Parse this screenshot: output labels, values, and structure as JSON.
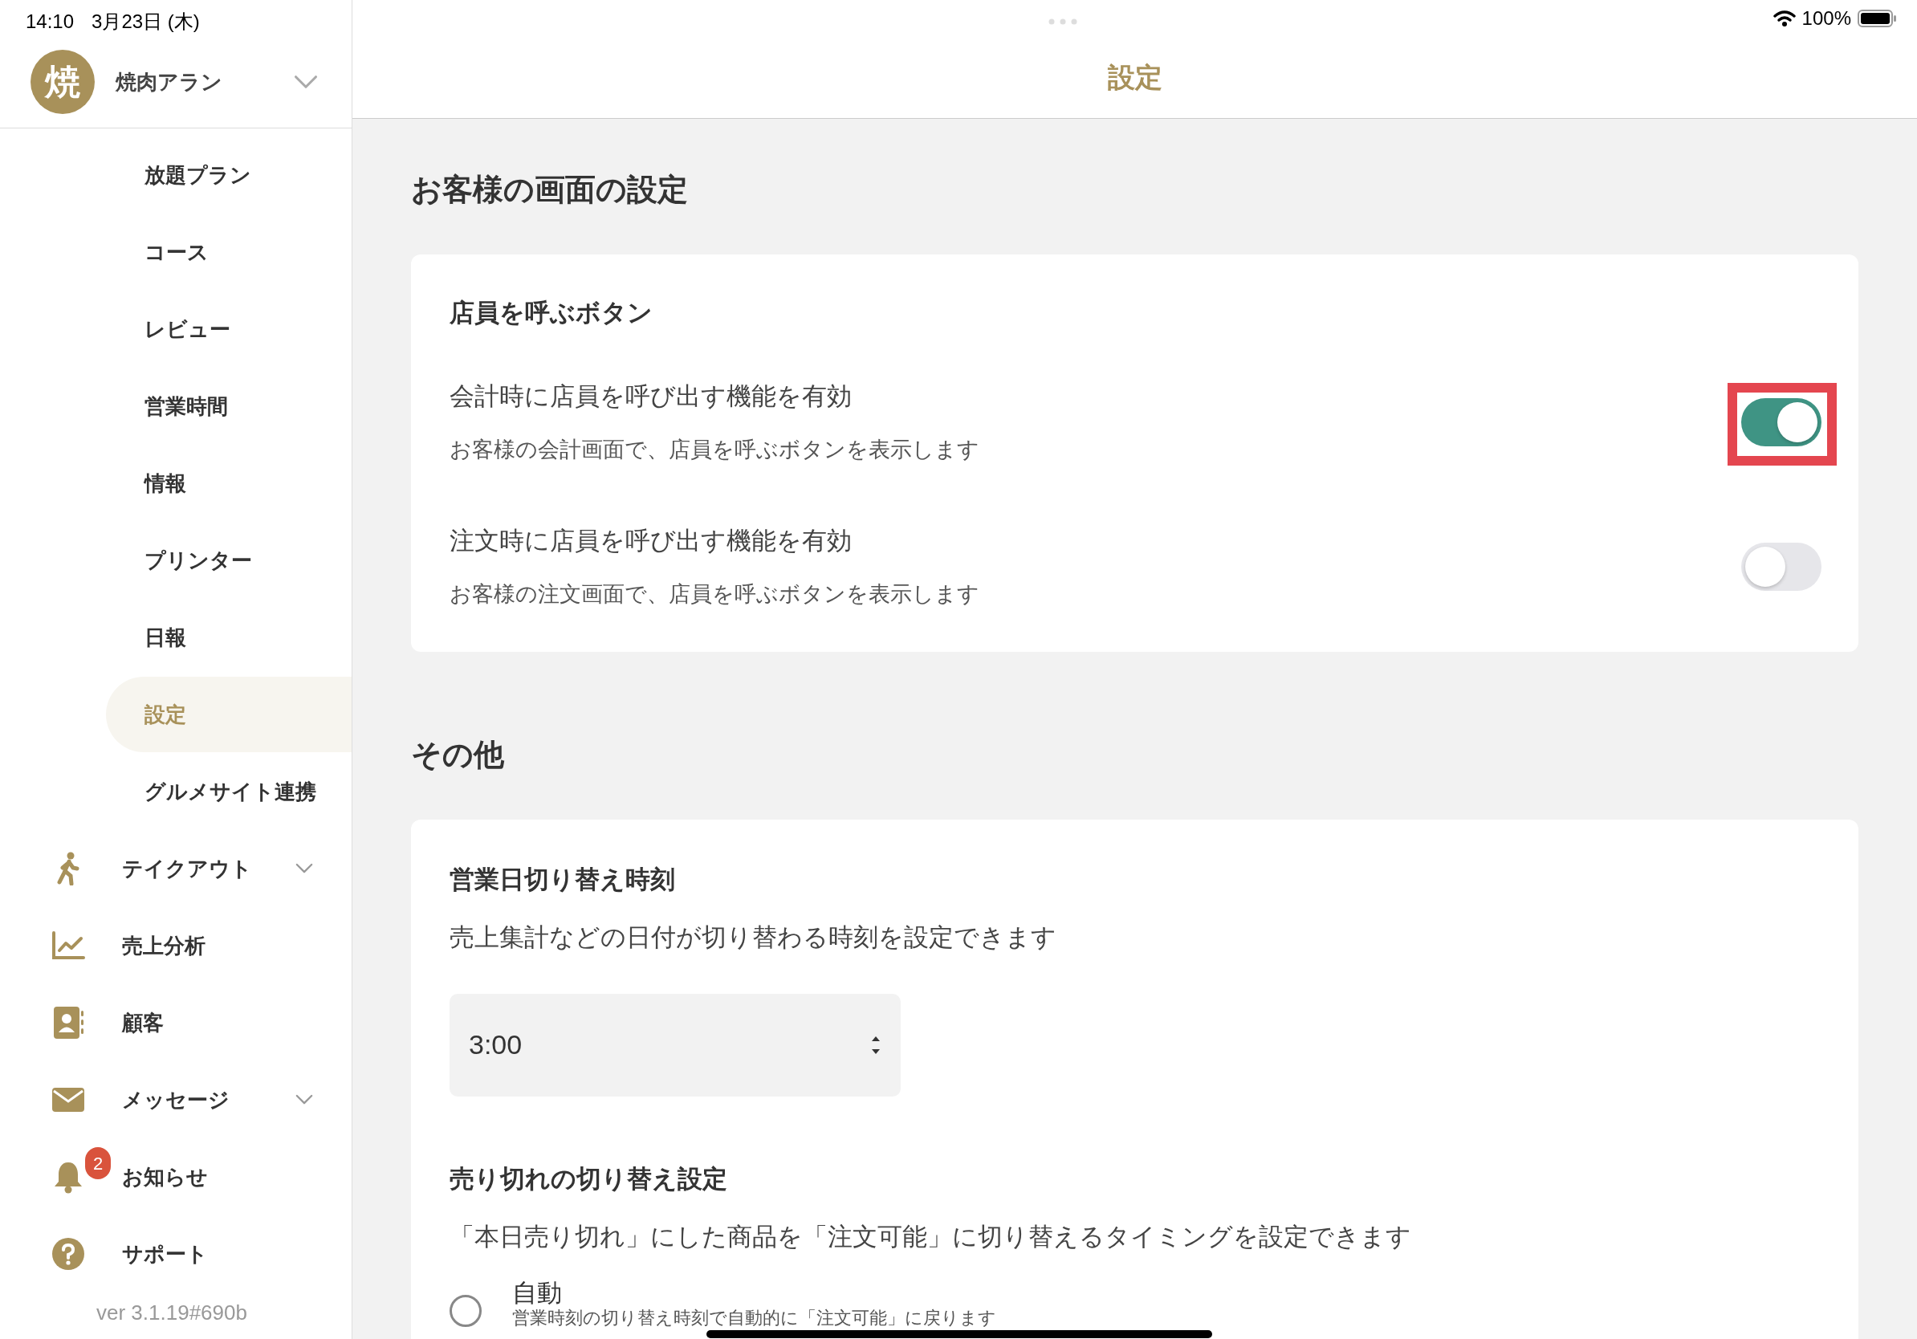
{
  "status_bar": {
    "time": "14:10",
    "date": "3月23日 (木)",
    "battery": "100%"
  },
  "store": {
    "avatar": "焼",
    "name": "焼肉アラン"
  },
  "sidebar": {
    "items": [
      {
        "label": "放題プラン",
        "selected": false
      },
      {
        "label": "コース",
        "selected": false
      },
      {
        "label": "レビュー",
        "selected": false
      },
      {
        "label": "営業時間",
        "selected": false
      },
      {
        "label": "情報",
        "selected": false
      },
      {
        "label": "プリンター",
        "selected": false
      },
      {
        "label": "日報",
        "selected": false
      },
      {
        "label": "設定",
        "selected": true
      },
      {
        "label": "グルメサイト連携",
        "selected": false
      }
    ],
    "nav": [
      {
        "label": "テイクアウト",
        "kind": "walk",
        "expandable": true
      },
      {
        "label": "売上分析",
        "kind": "chart",
        "expandable": false
      },
      {
        "label": "顧客",
        "kind": "contacts",
        "expandable": false
      },
      {
        "label": "メッセージ",
        "kind": "mail",
        "expandable": true
      },
      {
        "label": "お知らせ",
        "kind": "bell",
        "expandable": false,
        "badge": "2"
      },
      {
        "label": "サポート",
        "kind": "help",
        "expandable": false
      }
    ],
    "version": "ver 3.1.19#690b"
  },
  "header": {
    "title": "設定"
  },
  "sections": [
    {
      "title": "お客様の画面の設定",
      "card": {
        "title": "店員を呼ぶボタン",
        "toggles": [
          {
            "label": "会計時に店員を呼び出す機能を有効",
            "description": "お客様の会計画面で、店員を呼ぶボタンを表示します",
            "on": true,
            "highlighted": true
          },
          {
            "label": "注文時に店員を呼び出す機能を有効",
            "description": "お客様の注文画面で、店員を呼ぶボタンを表示します",
            "on": false,
            "highlighted": false
          }
        ]
      }
    },
    {
      "title": "その他",
      "card": {
        "blocks": [
          {
            "kind": "select",
            "title": "営業日切り替え時刻",
            "description": "売上集計などの日付が切り替わる時刻を設定できます",
            "value": "3:00"
          },
          {
            "kind": "radio",
            "title": "売り切れの切り替え設定",
            "description": "「本日売り切れ」にした商品を「注文可能」に切り替えるタイミングを設定できます",
            "options": [
              {
                "label": "自動",
                "description": "営業時刻の切り替え時刻で自動的に「注文可能」に戻ります",
                "selected": false
              }
            ]
          }
        ]
      }
    }
  ]
}
